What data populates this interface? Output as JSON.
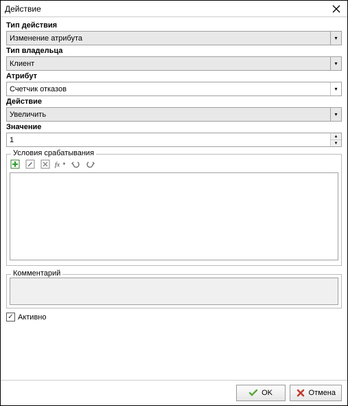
{
  "window": {
    "title": "Действие"
  },
  "fields": {
    "action_type": {
      "label": "Тип действия",
      "value": "Изменение атрибута"
    },
    "owner_type": {
      "label": "Тип владельца",
      "value": "Клиент"
    },
    "attribute": {
      "label": "Атрибут",
      "value": "Счетчик отказов"
    },
    "action": {
      "label": "Действие",
      "value": "Увеличить"
    },
    "value": {
      "label": "Значение",
      "value": "1"
    }
  },
  "conditions": {
    "legend": "Условия срабатывания",
    "text": ""
  },
  "comment": {
    "legend": "Комментарий",
    "text": ""
  },
  "active": {
    "label": "Активно",
    "checked": true
  },
  "buttons": {
    "ok": "OK",
    "cancel": "Отмена"
  }
}
